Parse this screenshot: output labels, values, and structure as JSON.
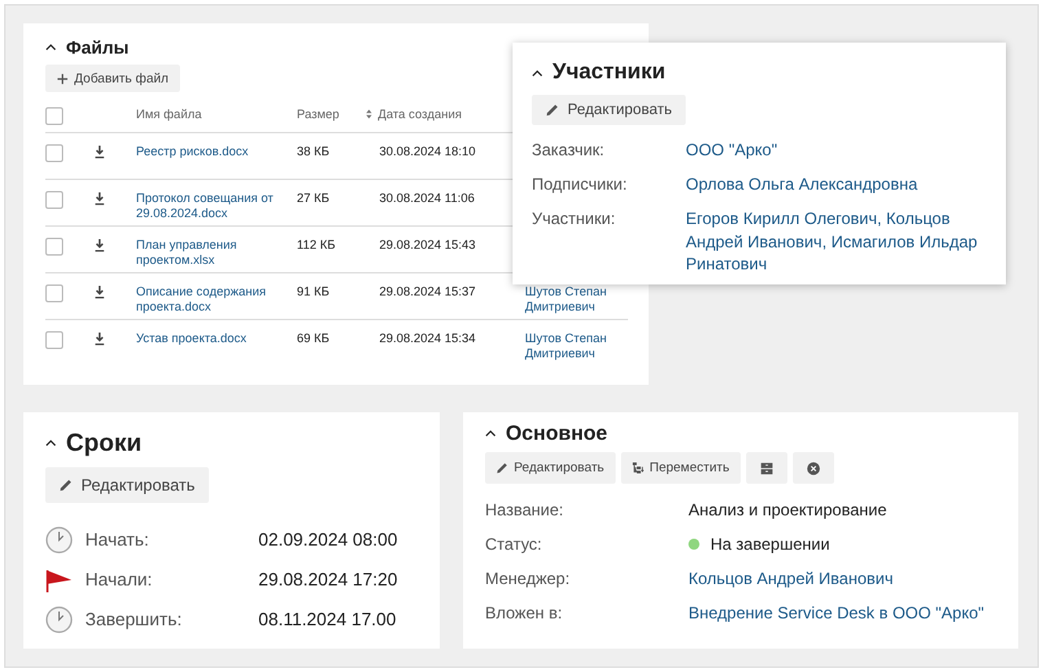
{
  "files": {
    "title": "Файлы",
    "add_button": "Добавить файл",
    "columns": [
      "Имя файла",
      "Размер",
      "Дата создания"
    ],
    "select_all_checked": false,
    "rows": [
      {
        "name": "Реестр рисков.docx",
        "size": "38 КБ",
        "date": "30.08.2024 18:10",
        "checked": false
      },
      {
        "name": "Протокол совещания от 29.08.2024.docx",
        "size": "27 КБ",
        "date": "30.08.2024 11:06",
        "checked": false
      },
      {
        "name": "План управления проектом.xlsx",
        "size": "112 КБ",
        "date": "29.08.2024 15:43",
        "checked": false
      },
      {
        "name": "Описание содержания проекта.docx",
        "size": "91 КБ",
        "date": "29.08.2024 15:37",
        "author": "Шутов Степан Дмитриевич",
        "checked": false
      },
      {
        "name": "Устав проекта.docx",
        "size": "69 КБ",
        "date": "29.08.2024 15:34",
        "author": "Шутов Степан Дмитриевич",
        "checked": false
      }
    ]
  },
  "participants": {
    "title": "Участники",
    "edit_button": "Редактировать",
    "fields": [
      {
        "label": "Заказчик:",
        "value": "ООО \"Арко\""
      },
      {
        "label": "Подписчики:",
        "value": "Орлова Ольга Александровна"
      },
      {
        "label": "Участники:",
        "value": "Егоров Кирилл Олегович, Кольцов Андрей Иванович, Исмагилов Ильдар Ринатович"
      }
    ]
  },
  "deadlines": {
    "title": "Сроки",
    "edit_button": "Редактировать",
    "rows": [
      {
        "kind": "clock",
        "label": "Начать:",
        "value": "02.09.2024 08:00"
      },
      {
        "kind": "flag",
        "label": "Начали:",
        "value": "29.08.2024 17:20"
      },
      {
        "kind": "clock",
        "label": "Завершить:",
        "value": "08.11.2024 17.00"
      }
    ]
  },
  "main": {
    "title": "Основное",
    "edit_button": "Редактировать",
    "move_button": "Переместить",
    "fields": [
      {
        "kind": "text",
        "label": "Название:",
        "value": "Анализ и проектирование"
      },
      {
        "kind": "status",
        "label": "Статус:",
        "value": "На завершении",
        "color": "#8fd67f"
      },
      {
        "kind": "link",
        "label": "Менеджер:",
        "value": "Кольцов Андрей Иванович"
      },
      {
        "kind": "link",
        "label": "Вложен в:",
        "value": "Внедрение Service Desk в ООО \"Арко\""
      }
    ]
  }
}
